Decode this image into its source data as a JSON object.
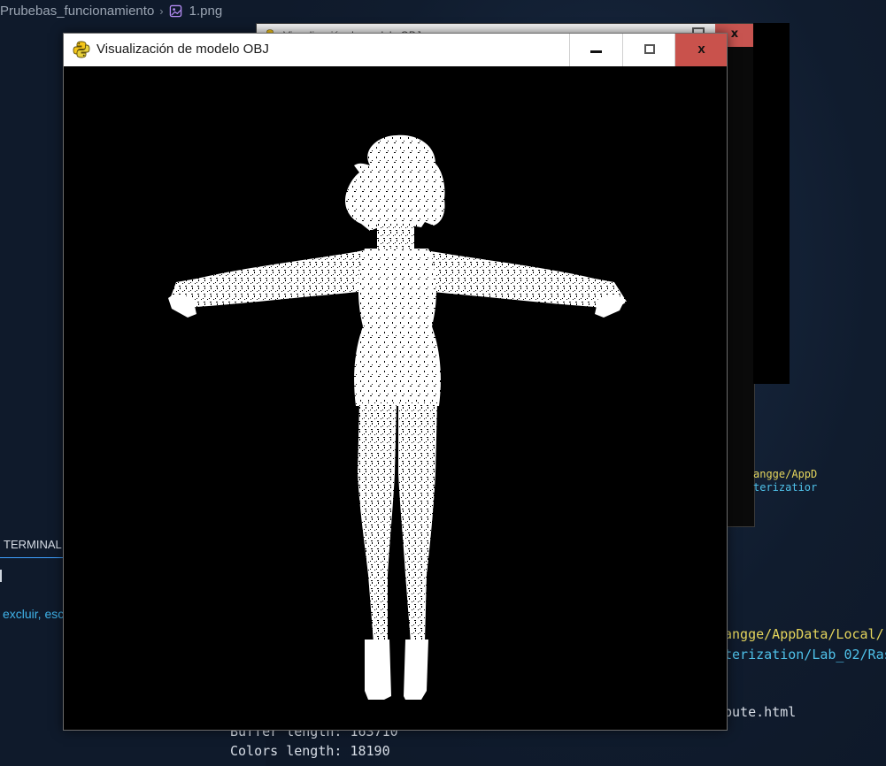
{
  "editor": {
    "breadcrumb": {
      "folder": "Prubebas_funcionamiento",
      "file": "1.png"
    },
    "terminal_tab": "TERMINAL",
    "terminal_left_text": "excluir, esc",
    "terminal_right": {
      "line1": "angge/AppData/Local/",
      "line2": "terization/Lab_02/Ras",
      "line3": "bute.html"
    },
    "terminal_bottom": {
      "buffer": "Buffer length: 163710",
      "colors": "Colors length: 18190"
    }
  },
  "back_window": {
    "title": "Visualización de modelo OBJ",
    "close_label": "x",
    "console_line1": "angge/AppD",
    "console_line2": "terizatior"
  },
  "main_window": {
    "title": "Visualización de modelo OBJ",
    "close_label": "x",
    "viewport_background": "#000000",
    "model_color": "#ffffff",
    "icons": {
      "app": "python-icon",
      "minimize": "minimize-icon",
      "maximize": "maximize-icon",
      "close": "close-icon"
    }
  },
  "colors": {
    "editor_bg": "#0f1a2b",
    "close_red": "#c9524c",
    "terminal_yellow": "#e5d55c",
    "terminal_cyan": "#4fc1e9",
    "terminal_accent": "#3fa0ff"
  }
}
